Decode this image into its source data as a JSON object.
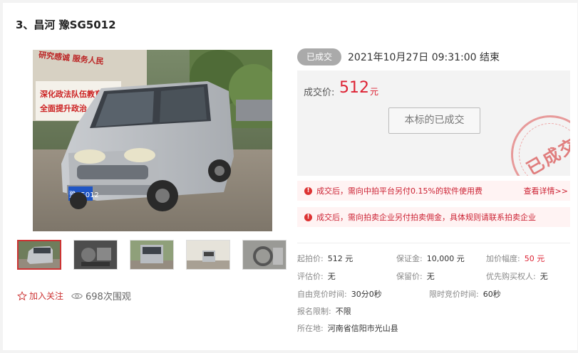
{
  "lot": {
    "title": "3、昌河 豫SG5012"
  },
  "photo": {
    "plate_text": "豫S5012",
    "banner_top": "研究感诚 服务人民",
    "banner_1": "深化政法队伍教育整",
    "banner_2": "全面提升政治"
  },
  "thumbnails": [
    {
      "name": "thumb-front"
    },
    {
      "name": "thumb-engine"
    },
    {
      "name": "thumb-rear"
    },
    {
      "name": "thumb-side"
    },
    {
      "name": "thumb-interior"
    }
  ],
  "actions": {
    "follow_label": "加入关注",
    "views_label": "698次围观"
  },
  "auction": {
    "status": "已成交",
    "end_time": "2021年10月27日  09:31:00 结束",
    "price_label": "成交价:",
    "price_value": "512",
    "price_unit": "元",
    "closed_button": "本标的已成交",
    "stamp_text": "已成交"
  },
  "notices": [
    {
      "text": "成交后，需向中拍平台另付0.15%的软件使用费",
      "link": "查看详情>>"
    },
    {
      "text": "成交后，需向拍卖企业另付拍卖佣金，具体规则请联系拍卖企业"
    }
  ],
  "info": {
    "start_price": {
      "label": "起拍价:",
      "value": "512 元"
    },
    "deposit": {
      "label": "保证金:",
      "value": "10,000 元"
    },
    "increment": {
      "label": "加价幅度:",
      "value": "50 元"
    },
    "appraisal": {
      "label": "评估价:",
      "value": "无"
    },
    "reserve": {
      "label": "保留价:",
      "value": "无"
    },
    "priority": {
      "label": "优先购买权人:",
      "value": "无"
    },
    "free_bid": {
      "label": "自由竞价时间:",
      "value": "30分0秒"
    },
    "timed_bid": {
      "label": "限时竞价时间:",
      "value": "60秒"
    },
    "registration": {
      "label": "报名限制:",
      "value": "不限"
    },
    "location": {
      "label": "所在地:",
      "value": "河南省信阳市光山县"
    }
  },
  "colors": {
    "accent": "#dd2233",
    "badge_gray": "#aaaaaa",
    "notice_bg": "#fff3f3"
  },
  "icons": {
    "follow": "star-icon",
    "views": "eye-icon",
    "notice": "alert-icon"
  }
}
